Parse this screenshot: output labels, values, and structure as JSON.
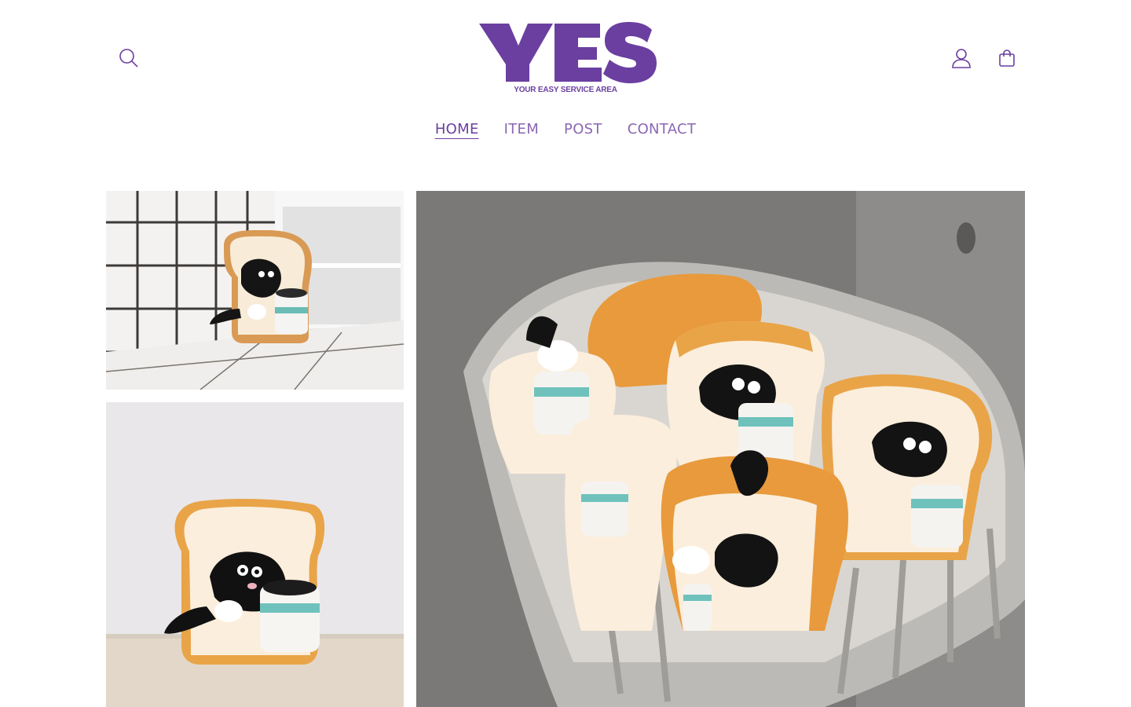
{
  "header": {
    "logo": {
      "text": "YES",
      "tagline": "YOUR EASY SERVICE AREA",
      "color": "#6b3fa0"
    },
    "icons": {
      "search": "search-icon",
      "account": "user-icon",
      "cart": "shopping-bag-icon"
    }
  },
  "nav": {
    "items": [
      {
        "label": "HOME",
        "active": true
      },
      {
        "label": "ITEM",
        "active": false
      },
      {
        "label": "POST",
        "active": false
      },
      {
        "label": "CONTACT",
        "active": false
      }
    ]
  },
  "gallery": {
    "images": [
      {
        "subject": "toast plush with coffee cup on tiled window ledge"
      },
      {
        "subject": "toast plush with coffee cup against white wall"
      },
      {
        "subject": "basket full of toast plush toys"
      }
    ]
  },
  "colors": {
    "brand": "#6b3fa0",
    "nav_inactive": "#8a67b3",
    "background": "#ffffff"
  }
}
